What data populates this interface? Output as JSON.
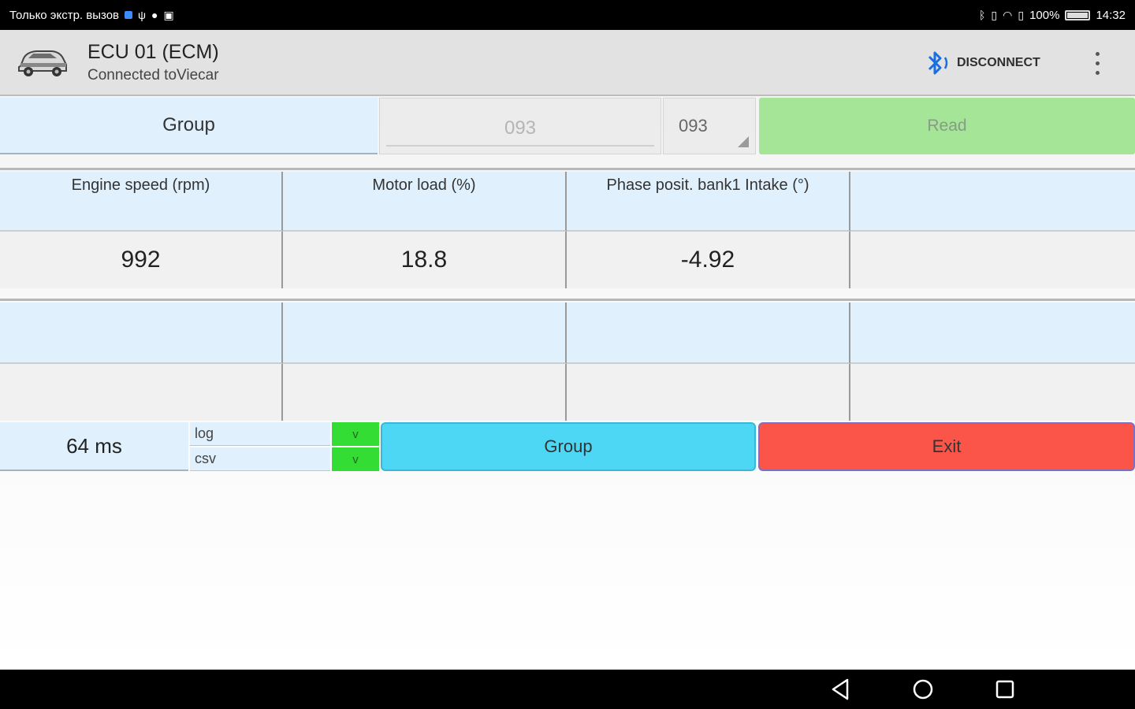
{
  "statusbar": {
    "carrier": "Только экстр. вызов",
    "battery": "100%",
    "time": "14:32"
  },
  "app": {
    "title": "ECU 01 (ECM)",
    "subtitle": "Connected toViecar",
    "disconnect_label": "DISCONNECT"
  },
  "group_bar": {
    "label": "Group",
    "input_value": "093",
    "select_value": "093",
    "read_label": "Read"
  },
  "measurements": {
    "headers": [
      "Engine speed (rpm)",
      "Motor load (%)",
      "Phase posit. bank1 Intake (°)",
      ""
    ],
    "values": [
      "992",
      "18.8",
      "-4.92",
      ""
    ]
  },
  "empty_block": {
    "headers": [
      "",
      "",
      "",
      ""
    ],
    "values": [
      "",
      "",
      "",
      ""
    ]
  },
  "bottom": {
    "timer": "64 ms",
    "options": [
      {
        "label": "log",
        "check": "v"
      },
      {
        "label": "csv",
        "check": "v"
      }
    ],
    "group_button": "Group",
    "exit_button": "Exit"
  },
  "colors": {
    "read_button": "#a4e598",
    "group_button": "#4dd7f5",
    "exit_button": "#fa5548",
    "check_green": "#33dd33",
    "cell_blue": "#e0f1fd"
  }
}
